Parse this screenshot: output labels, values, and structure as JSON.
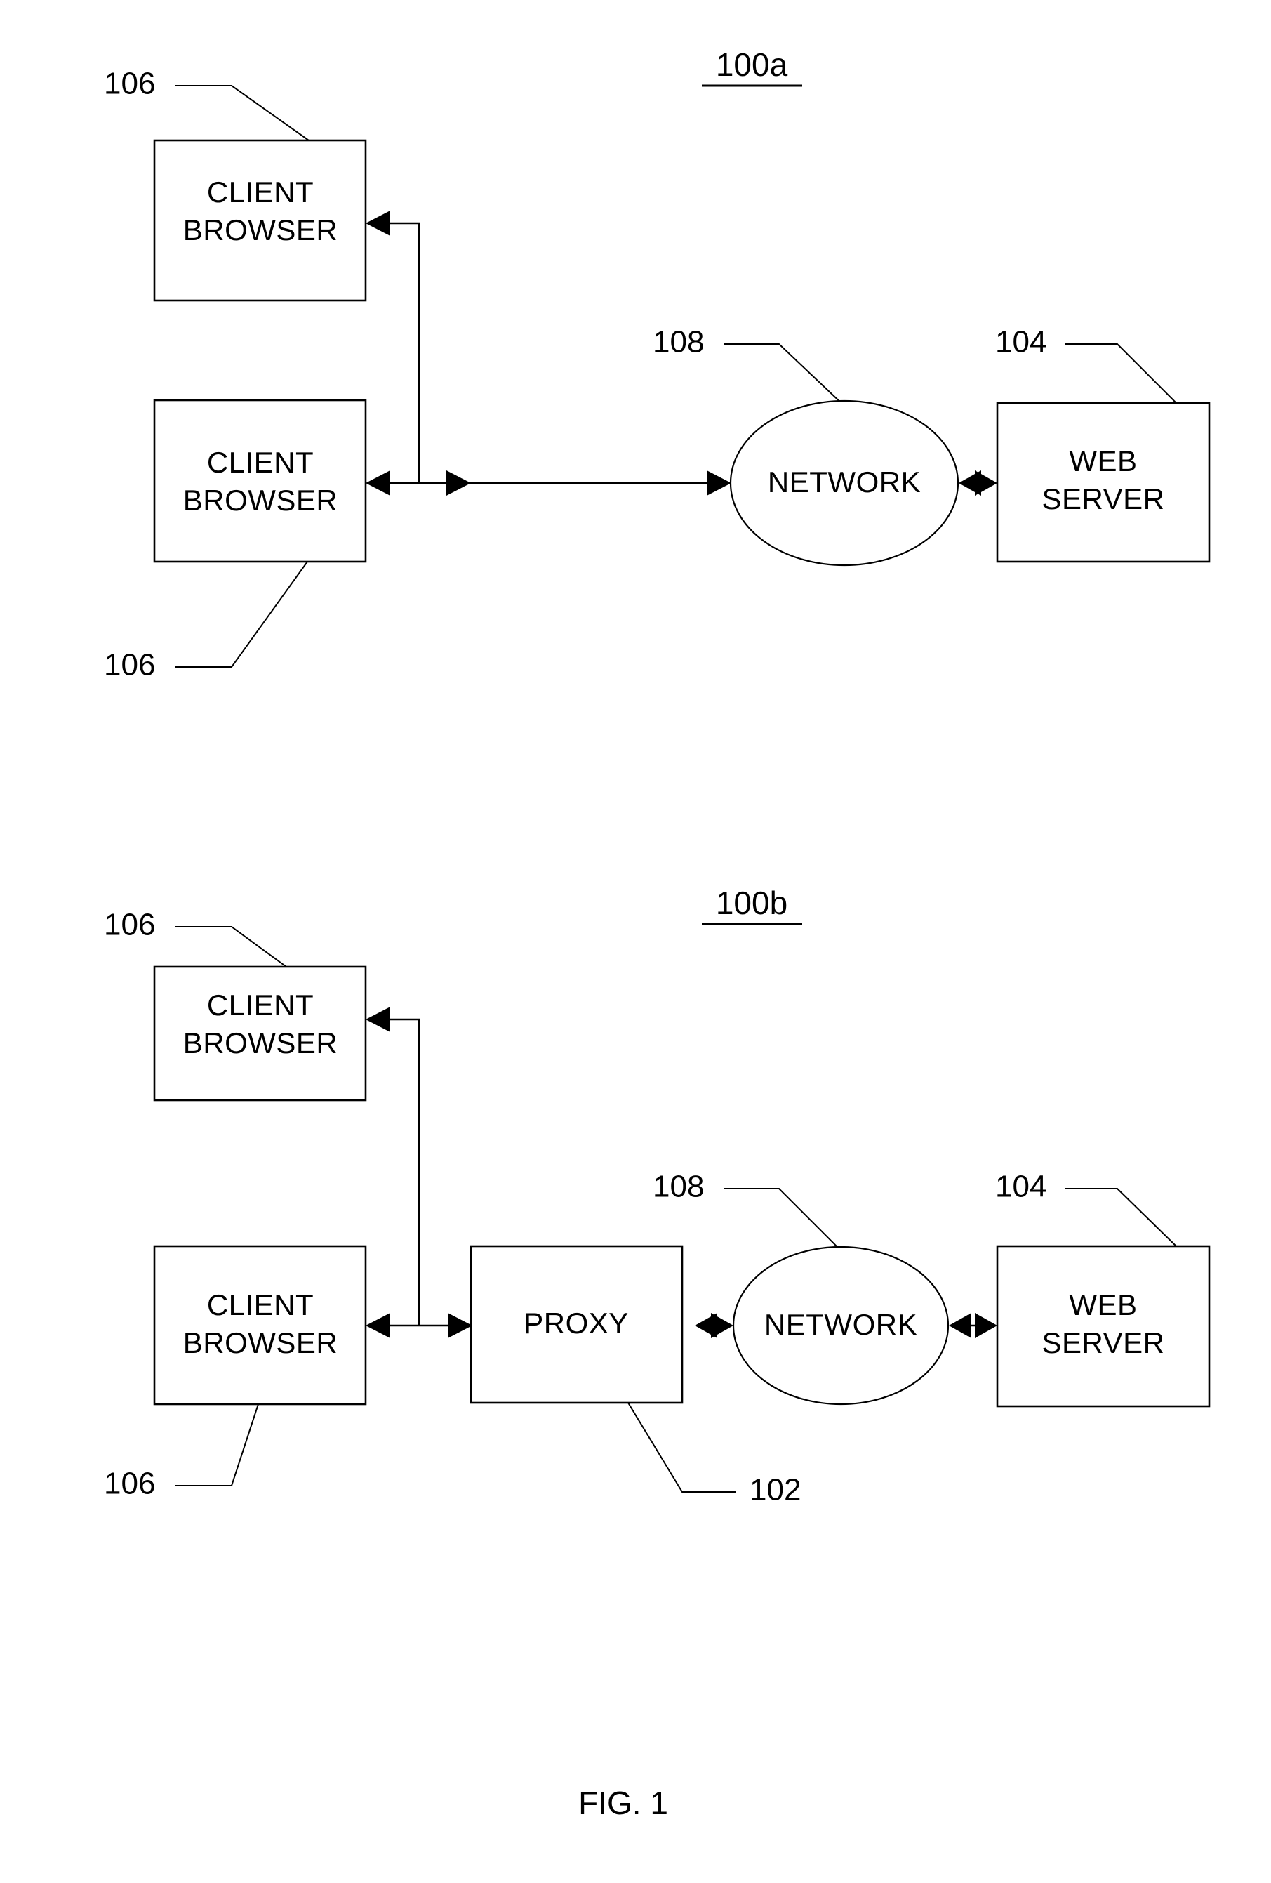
{
  "figure": {
    "caption": "FIG. 1",
    "background_color": "#ffffff",
    "line_color": "#000000"
  },
  "diagrams": [
    {
      "id": "100a",
      "title": "100a",
      "nodes": {
        "client_browser_top": {
          "line1": "CLIENT",
          "line2": "BROWSER"
        },
        "client_browser_bottom": {
          "line1": "CLIENT",
          "line2": "BROWSER"
        },
        "network": {
          "label": "NETWORK"
        },
        "web_server": {
          "line1": "WEB",
          "line2": "SERVER"
        }
      },
      "reference_numerals": {
        "client_browser_top": "106",
        "client_browser_bottom": "106",
        "network": "108",
        "web_server": "104"
      }
    },
    {
      "id": "100b",
      "title": "100b",
      "nodes": {
        "client_browser_top": {
          "line1": "CLIENT",
          "line2": "BROWSER"
        },
        "client_browser_bottom": {
          "line1": "CLIENT",
          "line2": "BROWSER"
        },
        "proxy": {
          "label": "PROXY"
        },
        "network": {
          "label": "NETWORK"
        },
        "web_server": {
          "line1": "WEB",
          "line2": "SERVER"
        }
      },
      "reference_numerals": {
        "client_browser_top": "106",
        "client_browser_bottom": "106",
        "proxy": "102",
        "network": "108",
        "web_server": "104"
      }
    }
  ]
}
